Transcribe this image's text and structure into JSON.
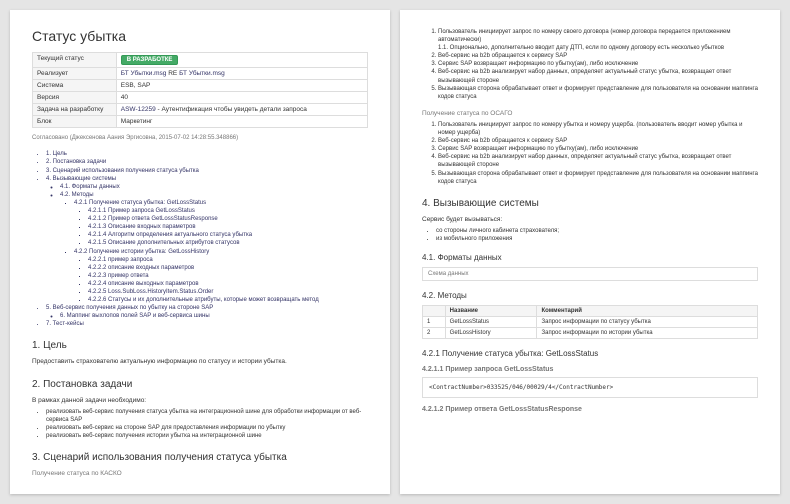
{
  "title": "Статус убытка",
  "meta": {
    "r1": {
      "k": "Текущий статус",
      "v": "В РАЗРАБОТКЕ"
    },
    "r2": {
      "k": "Реализует",
      "l1": "БТ Убытки.msg",
      "mid": " RE ",
      "l2": "БТ Убытки.msg"
    },
    "r3": {
      "k": "Система",
      "v": "ESB, SAP"
    },
    "r4": {
      "k": "Версия",
      "v": "40"
    },
    "r5": {
      "k": "Задача на разработку",
      "link": "ASW-12259",
      "after": " - Аутентификация чтобы увидеть детали запроса"
    },
    "r6": {
      "k": "Блок",
      "v": "Маркетинг"
    }
  },
  "stamp": "Согласовано (Джексенова Аания Эргисовна, 2015-07-02 14:28:55.348866)",
  "toc": {
    "n1": "1. Цель",
    "n2": "2. Постановка задачи",
    "n3": "3. Сценарий использования получения статуса убытка",
    "n4": "4. Вызывающие системы",
    "n41": "4.1. Форматы данных",
    "n42": "4.2. Методы",
    "n421": "4.2.1 Получение статуса убытка: GetLossStatus",
    "n4211": "4.2.1.1 Пример запроса GetLossStatus",
    "n4212": "4.2.1.2 Пример ответа GetLossStatusResponse",
    "n4213": "4.2.1.3 Описание входных параметров",
    "n4214": "4.2.1.4 Алгоритм определения актуального статуса убытка",
    "n4215": "4.2.1.5 Описание дополнительных атрибутов статусов",
    "n422": "4.2.2 Получение истории убытка: GetLossHistory",
    "n4221": "4.2.2.1 пример запроса",
    "n4222": "4.2.2.2 описание входных параметров",
    "n4223": "4.2.2.3 пример ответа",
    "n4224": "4.2.2.4 описание выходных параметров",
    "n4225": "4.2.2.5 Loss.SubLoss.HistoryItem.Status.Order",
    "n4226": "4.2.2.6 Статусы и их дополнительные атрибуты, которые может возвращать метод",
    "n5": "5. Веб-сервис получения данных по убытку на стороне SAP",
    "n6": "6. Маппинг выхлопов полей SAP и веб-сервиса шины",
    "n7": "7. Тест-кейсы"
  },
  "h1": "1. Цель",
  "p1": "Предоставить страхователю актуальную информацию по статусу и истории убытка.",
  "h2": "2. Постановка задачи",
  "p2intro": "В рамках данной задачи необходимо:",
  "p2a": "реализовать веб-сервис получения статуса убытка на интеграционной шине для обработки информации от веб-сервиса SAP",
  "p2b": "реализовать веб-сервис на стороне SAP для предоставления информации по убытку",
  "p2c": "реализовать веб-сервис получения истории убытка на интеграционной шине",
  "h3": "3. Сценарий использования получения статуса убытка",
  "p3": "Получение статуса по КАСКО",
  "right": {
    "kasko": {
      "o1": "Пользователь инициирует запрос по номеру своего договора (номер договора передается приложением автоматически)",
      "o11": "1.1. Опционально, дополнительно вводит дату ДТП, если по одному договору есть несколько убытков",
      "o2": "Веб-сервис на b2b обращается к сервису SAP",
      "o3": "Сервис SAP возвращает информацию по убытку(ам), либо исключение",
      "o4": "Веб-сервис на b2b анализирует набор данных, определяет актуальный статус убытка, возвращает ответ вызывающей стороне",
      "o5": "Вызывающая сторона обрабатывает ответ и формирует представление для пользователя на основании маппинга кодов статуса"
    },
    "osagoTitle": "Получение статуса по ОСАГО",
    "osago": {
      "o1": "Пользователь инициирует запрос по номеру убытка и номеру ущерба. (пользователь вводит номер убытка и номер ущерба)",
      "o2": "Веб-сервис на b2b обращается к сервису SAP",
      "o3": "Сервис SAP возвращает информацию по убытку(ам), либо исключение",
      "o4": "Веб-сервис на b2b анализирует набор данных, определяет актуальный статус убытка, возвращает ответ вызывающей стороне",
      "o5": "Вызывающая сторона обрабатывает ответ и формирует представление для пользователя на основании маппинга кодов статуса"
    },
    "h4": "4. Вызывающие системы",
    "p4": "Сервис будет вызываться:",
    "p4a": "со стороны личного кабинета страхователя;",
    "p4b": "из мобильного приложения",
    "h41": "4.1. Форматы данных",
    "schema": "Схема данных",
    "h42": "4.2. Методы",
    "th1": "",
    "th2": "Название",
    "th3": "Комментарий",
    "r1a": "1",
    "r1b": "GetLossStatus",
    "r1c": "Запрос информации по статусу убытка",
    "r2a": "2",
    "r2b": "GetLossHistory",
    "r2c": "Запрос информации по истории убытка",
    "h421": "4.2.1 Получение статуса убытка: GetLossStatus",
    "h4211": "4.2.1.1 Пример запроса GetLossStatus",
    "code": "<ContractNumber>033525/046/00029/4</ContractNumber>",
    "h4212": "4.2.1.2 Пример ответа GetLossStatusResponse"
  }
}
